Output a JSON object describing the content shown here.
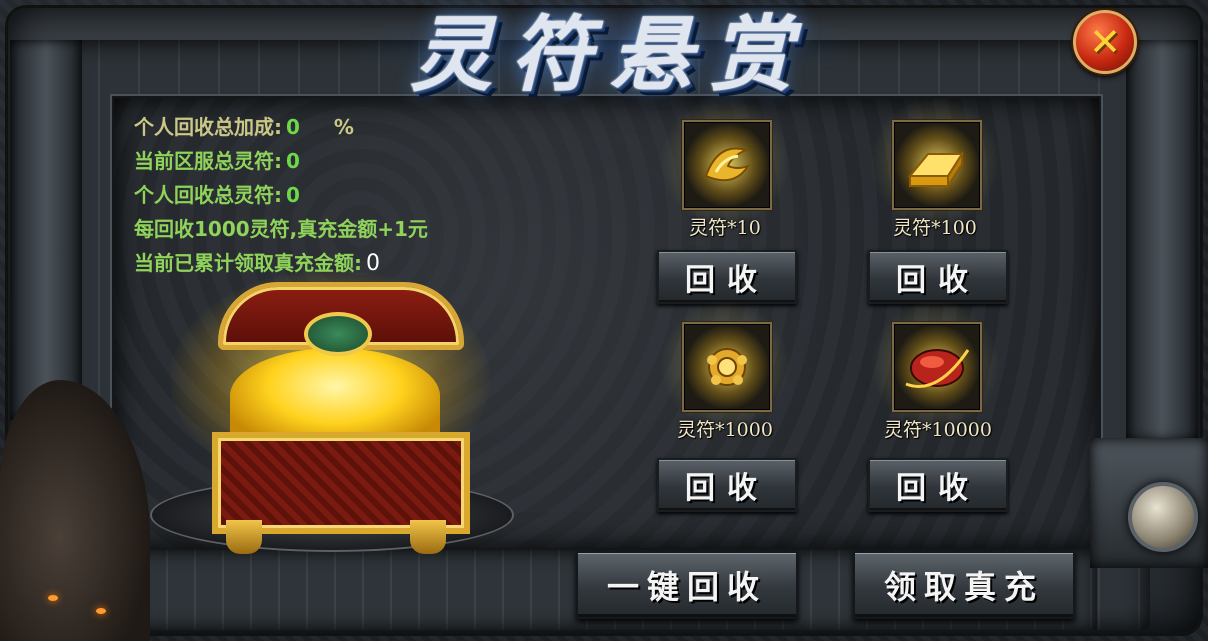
{
  "title": "灵符悬赏",
  "stats": {
    "bonus_label": "个人回收总加成:",
    "bonus_value": "0",
    "bonus_unit": "%",
    "server_label": "当前区服总灵符:",
    "server_value": "0",
    "personal_label": "个人回收总灵符:",
    "personal_value": "0",
    "rule_text": "每回收1000灵符,真充金额+1元",
    "claimed_label": "当前已累计领取真充金额:",
    "claimed_value": "0"
  },
  "items": [
    {
      "label": "灵符*10",
      "button": "回收",
      "icon": "golden-talisman-icon"
    },
    {
      "label": "灵符*100",
      "button": "回收",
      "icon": "gold-bar-icon"
    },
    {
      "label": "灵符*1000",
      "button": "回收",
      "icon": "golden-ornament-icon"
    },
    {
      "label": "灵符*10000",
      "button": "回收",
      "icon": "red-gem-icon"
    }
  ],
  "actions": {
    "recycle_all": "一键回收",
    "claim": "领取真充"
  },
  "close_label": "✕"
}
